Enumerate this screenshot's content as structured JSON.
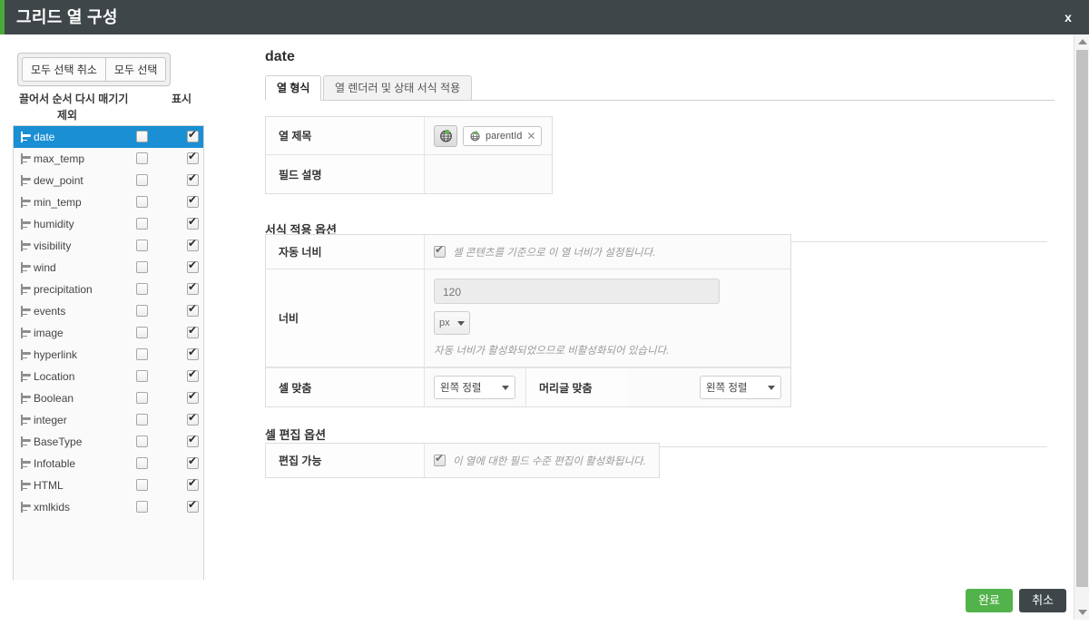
{
  "window": {
    "title": "그리드 열 구성",
    "close_label": "x"
  },
  "sidebar": {
    "buttons": {
      "deselect_all": "모두 선택 취소",
      "select_all": "모두 선택"
    },
    "headers": {
      "reorder": "끌어서 순서 다시 매기기",
      "show": "표시",
      "exclude": "제외"
    },
    "items": [
      {
        "label": "date",
        "exclude": false,
        "show": true,
        "selected": true
      },
      {
        "label": "max_temp",
        "exclude": false,
        "show": true,
        "selected": false
      },
      {
        "label": "dew_point",
        "exclude": false,
        "show": true,
        "selected": false
      },
      {
        "label": "min_temp",
        "exclude": false,
        "show": true,
        "selected": false
      },
      {
        "label": "humidity",
        "exclude": false,
        "show": true,
        "selected": false
      },
      {
        "label": "visibility",
        "exclude": false,
        "show": true,
        "selected": false
      },
      {
        "label": "wind",
        "exclude": false,
        "show": true,
        "selected": false
      },
      {
        "label": "precipitation",
        "exclude": false,
        "show": true,
        "selected": false
      },
      {
        "label": "events",
        "exclude": false,
        "show": true,
        "selected": false
      },
      {
        "label": "image",
        "exclude": false,
        "show": true,
        "selected": false
      },
      {
        "label": "hyperlink",
        "exclude": false,
        "show": true,
        "selected": false
      },
      {
        "label": "Location",
        "exclude": false,
        "show": true,
        "selected": false
      },
      {
        "label": "Boolean",
        "exclude": false,
        "show": true,
        "selected": false
      },
      {
        "label": "integer",
        "exclude": false,
        "show": true,
        "selected": false
      },
      {
        "label": "BaseType",
        "exclude": false,
        "show": true,
        "selected": false
      },
      {
        "label": "Infotable",
        "exclude": false,
        "show": true,
        "selected": false
      },
      {
        "label": "HTML",
        "exclude": false,
        "show": true,
        "selected": false
      },
      {
        "label": "xmlkids",
        "exclude": false,
        "show": true,
        "selected": false
      }
    ]
  },
  "detail": {
    "column_name": "date",
    "tabs": [
      {
        "label": "열 형식",
        "active": true
      },
      {
        "label": "열 렌더러 및 상태 서식 적용",
        "active": false
      }
    ],
    "title_table": {
      "column_title_label": "열 제목",
      "column_title_chip": "parentId",
      "chip_remove": "✕",
      "field_description_label": "필드 설명",
      "field_description_value": ""
    },
    "format_section": {
      "title": "서식 적용 옵션",
      "auto_width_label": "자동 너비",
      "auto_width_checked": true,
      "auto_width_hint": "셀 콘텐츠를 기준으로 이 열 너비가 설정됩니다.",
      "width_label": "너비",
      "width_value": "120",
      "width_unit": "px",
      "width_note": "자동 너비가 활성화되었으므로 비활성화되어 있습니다.",
      "cell_align_label": "셀 맞춤",
      "cell_align_value": "왼쪽 정렬",
      "header_align_label": "머리글 맞춤",
      "header_align_value": "왼쪽 정렬"
    },
    "edit_section": {
      "title": "셀 편집 옵션",
      "editable_label": "편집 가능",
      "editable_checked": true,
      "editable_hint": "이 열에 대한 필드 수준 편집이 활성화됩니다."
    }
  },
  "footer": {
    "done": "완료",
    "cancel": "취소"
  },
  "colors": {
    "titlebar": "#3e4649",
    "accent_green": "#4aa93b",
    "selection_blue": "#1a8fd4",
    "done_button": "#53b34b",
    "cancel_button": "#3e4649"
  }
}
